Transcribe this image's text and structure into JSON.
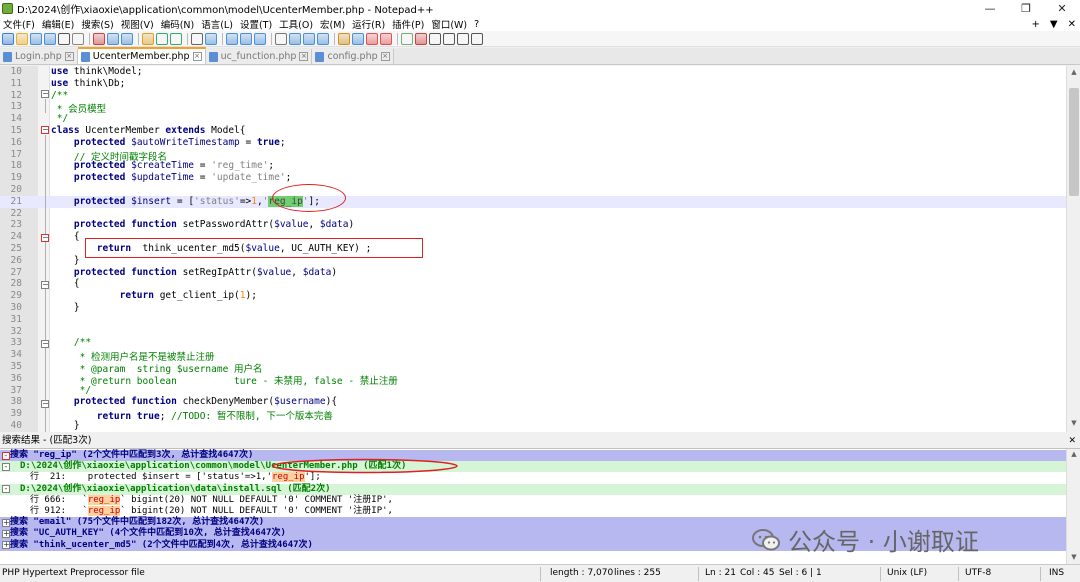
{
  "window": {
    "title": "D:\\2024\\创作\\xiaoxie\\application\\common\\model\\UcenterMember.php - Notepad++",
    "minimize": "—",
    "maximize": "❐",
    "close": "✕"
  },
  "menu": {
    "items": [
      "文件(F)",
      "编辑(E)",
      "搜索(S)",
      "视图(V)",
      "编码(N)",
      "语言(L)",
      "设置(T)",
      "工具(O)",
      "宏(M)",
      "运行(R)",
      "插件(P)",
      "窗口(W)",
      "?"
    ],
    "right": [
      "+",
      "▼",
      "✕"
    ]
  },
  "tabs": [
    {
      "label": "Login.php",
      "active": false
    },
    {
      "label": "UcenterMember.php",
      "active": true
    },
    {
      "label": "uc_function.php",
      "active": false
    },
    {
      "label": "config.php",
      "active": false
    }
  ],
  "code": {
    "lines": [
      {
        "n": "10",
        "html": "<span class=\"kw\">use</span> think\\Model;"
      },
      {
        "n": "11",
        "html": "<span class=\"kw\">use</span> think\\Db;"
      },
      {
        "n": "12",
        "html": "<span class=\"cm\">/**</span>"
      },
      {
        "n": "13",
        "html": "<span class=\"cm\"> * 会员模型</span>"
      },
      {
        "n": "14",
        "html": "<span class=\"cm\"> */</span>"
      },
      {
        "n": "15",
        "html": "<span class=\"kw\">class</span> UcenterMember <span class=\"kw\">extends</span> Model{"
      },
      {
        "n": "16",
        "html": "    <span class=\"kw\">protected</span> <span class=\"vr\">$autoWriteTimestamp</span> = <span class=\"kw\">true</span>;"
      },
      {
        "n": "17",
        "html": "    <span class=\"cm\">// 定义时间戳字段名</span>"
      },
      {
        "n": "18",
        "html": "    <span class=\"kw\">protected</span> <span class=\"vr\">$createTime</span> = <span class=\"str\">'reg_time'</span>;"
      },
      {
        "n": "19",
        "html": "    <span class=\"kw\">protected</span> <span class=\"vr\">$updateTime</span> = <span class=\"str\">'update_time'</span>;"
      },
      {
        "n": "20",
        "html": ""
      },
      {
        "n": "21",
        "html": "    <span class=\"kw\">protected</span> <span class=\"vr\">$insert</span> = [<span class=\"str\">'status'</span>=&gt;<span class=\"num\">1</span>,<span class=\"str\">'</span><span class=\"hl-green\">reg_ip</span><span class=\"str\">'</span>];"
      },
      {
        "n": "22",
        "html": ""
      },
      {
        "n": "23",
        "html": "    <span class=\"kw\">protected</span> <span class=\"kw\">function</span> setPasswordAttr(<span class=\"vr\">$value</span>, <span class=\"vr\">$data</span>)"
      },
      {
        "n": "24",
        "html": "    {"
      },
      {
        "n": "25",
        "html": "        <span class=\"kw\">return</span>  think_ucenter_md5(<span class=\"vr\">$value</span>, UC_AUTH_KEY) ;"
      },
      {
        "n": "26",
        "html": "    }"
      },
      {
        "n": "27",
        "html": "    <span class=\"kw\">protected</span> <span class=\"kw\">function</span> setRegIpAttr(<span class=\"vr\">$value</span>, <span class=\"vr\">$data</span>)"
      },
      {
        "n": "28",
        "html": "    {"
      },
      {
        "n": "29",
        "html": "            <span class=\"kw\">return</span> get_client_ip(<span class=\"num\">1</span>);"
      },
      {
        "n": "30",
        "html": "    }"
      },
      {
        "n": "31",
        "html": ""
      },
      {
        "n": "32",
        "html": ""
      },
      {
        "n": "33",
        "html": "    <span class=\"cm\">/**</span>"
      },
      {
        "n": "34",
        "html": "<span class=\"cm\">     * 检测用户名是不是被禁止注册</span>"
      },
      {
        "n": "35",
        "html": "<span class=\"cm\">     * @param  string $username 用户名</span>"
      },
      {
        "n": "36",
        "html": "<span class=\"cm\">     * @return boolean          ture - 未禁用, false - 禁止注册</span>"
      },
      {
        "n": "37",
        "html": "<span class=\"cm\">     */</span>"
      },
      {
        "n": "38",
        "html": "    <span class=\"kw\">protected</span> <span class=\"kw\">function</span> checkDenyMember(<span class=\"vr\">$username</span>){"
      },
      {
        "n": "39",
        "html": "        <span class=\"kw\">return</span> <span class=\"kw\">true</span>; <span class=\"cm\">//TODO: 暂不限制, 下一个版本完善</span>"
      },
      {
        "n": "40",
        "html": "    }"
      }
    ],
    "current_line": "21"
  },
  "search": {
    "header": "搜索结果 - (匹配3次)",
    "close": "✕",
    "lines": [
      {
        "type": "search",
        "box": "-",
        "html": "搜索 \"reg_ip\" (2个文件中匹配到3次, 总计查找4647次)"
      },
      {
        "type": "file",
        "box": "-",
        "html": "D:\\2024\\创作\\xiaoxie\\application\\common\\model\\UcenterMember.php (匹配1次)"
      },
      {
        "type": "hit",
        "box": "",
        "html": "行  21:    protected $insert = ['status'=&gt;1,'<span class=\"sr-match\">reg_ip</span>'];"
      },
      {
        "type": "file",
        "box": "-",
        "html": "D:\\2024\\创作\\xiaoxie\\application\\data\\install.sql (匹配2次)"
      },
      {
        "type": "hit",
        "box": "",
        "html": "行 666:   `<span class=\"sr-match\">reg_ip</span>` bigint(20) NOT NULL DEFAULT '0' COMMENT '注册IP',"
      },
      {
        "type": "hit",
        "box": "",
        "html": "行 912:   `<span class=\"sr-match\">reg_ip</span>` bigint(20) NOT NULL DEFAULT '0' COMMENT '注册IP',"
      },
      {
        "type": "search",
        "box": "+",
        "html": "搜索 \"email\" (75个文件中匹配到182次, 总计查找4647次)"
      },
      {
        "type": "search",
        "box": "+",
        "html": "搜索 \"UC_AUTH_KEY\" (4个文件中匹配到10次, 总计查找4647次)"
      },
      {
        "type": "search",
        "box": "+",
        "html": "搜索 \"think_ucenter_md5\" (2个文件中匹配到4次, 总计查找4647次)"
      }
    ]
  },
  "watermark": "公众号 · 小谢取证",
  "status": {
    "lang": "PHP Hypertext Preprocessor file",
    "length": "length : 7,070",
    "lines": "lines : 255",
    "pos": "Ln : 21",
    "col": "Col : 45",
    "sel": "Sel : 6 | 1",
    "eol": "Unix (LF)",
    "enc": "UTF-8",
    "mode": "INS"
  },
  "colors": {
    "accent_tab": "#f0a02c",
    "annotation": "#e02020",
    "search_header": "#b8b8f0",
    "file_header": "#d6f5d6"
  }
}
